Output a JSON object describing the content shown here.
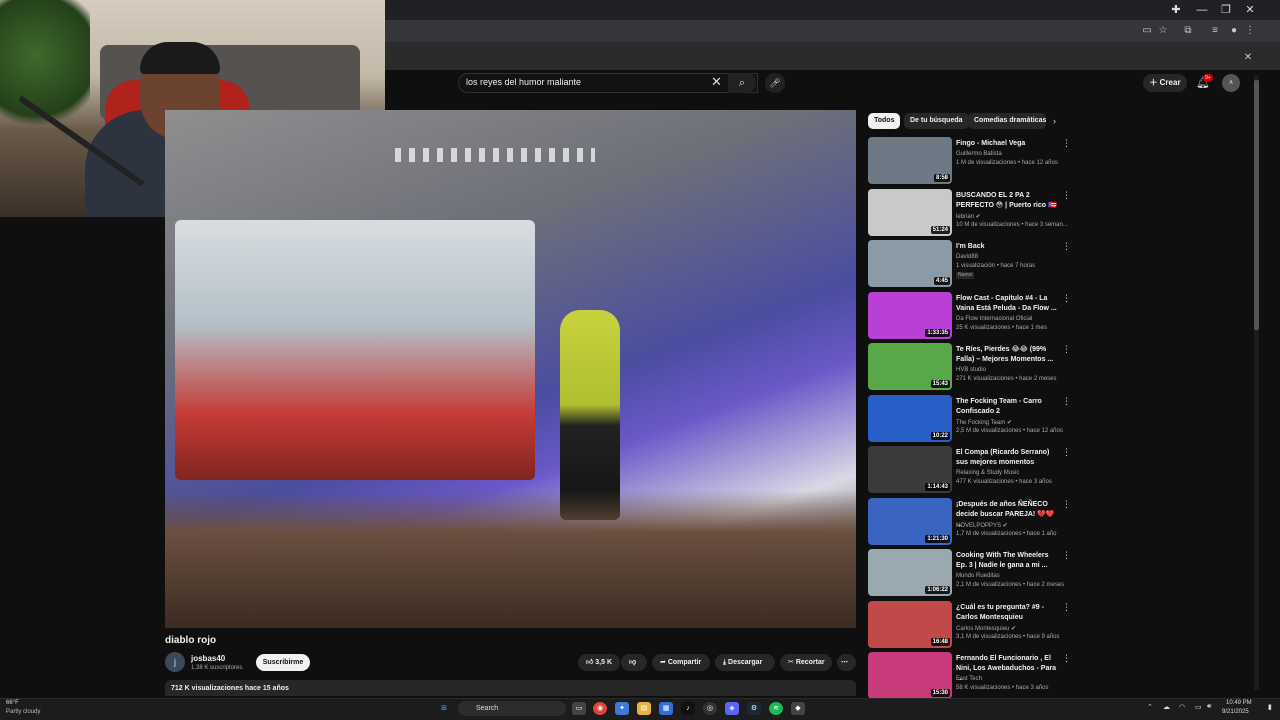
{
  "search": {
    "query": "los reyes del humor maliante"
  },
  "header": {
    "create_label": "Crear",
    "notif_count": "9+",
    "avatar_label": "A"
  },
  "video": {
    "title": "diablo rojo",
    "channel_initial": "j",
    "channel_name": "josbas40",
    "subscribers": "1,38 K suscriptores",
    "subscribe_label": "Suscribirme",
    "likes": "3,5 K",
    "share_label": "Compartir",
    "download_label": "Descargar",
    "clip_label": "Recortar",
    "description_meta": "712 K visualizaciones  hace 15 años"
  },
  "chips": [
    "Todos",
    "De tu búsqueda",
    "Comedias dramáticas"
  ],
  "recommendations": [
    {
      "title": "Fingo - Michael Vega",
      "channel": "Guillermo Batista",
      "meta": "1 M de visualizaciones • hace 12 años",
      "duration": "8:58",
      "thumb_color": "#6d7a86"
    },
    {
      "title": "BUSCANDO EL 2 PA 2 PERFECTO 😳 | Puerto rico 🇵🇷",
      "channel": "lebrian ✔",
      "meta": "10 M de visualizaciones • hace 3 seman...",
      "duration": "51:24",
      "thumb_color": "#c9c9c9"
    },
    {
      "title": "I'm Back",
      "channel": "David88",
      "meta": "1 visualización • hace 7 horas",
      "duration": "4:45",
      "badge": "Nuevo",
      "thumb_color": "#8a9aa6"
    },
    {
      "title": "Flow Cast - Capítulo #4 - La Vaina Está Peluda - Da Flow ...",
      "channel": "Da Flow Internacional Oficial",
      "meta": "25 K visualizaciones • hace 1 mes",
      "duration": "1:33:35",
      "thumb_color": "#b93fd6"
    },
    {
      "title": "Te Ríes, Pierdes 😂😂 (99% Falla) – Mejores Momentos ...",
      "channel": "HVB studio",
      "meta": "271 K visualizaciones • hace 2 meses",
      "duration": "15:43",
      "thumb_color": "#58a84a"
    },
    {
      "title": "The Focking Team - Carro Confiscado 2",
      "channel": "The Focking Team ✔",
      "meta": "2,5 M de visualizaciones • hace 12 años",
      "duration": "10:22",
      "thumb_color": "#2860c8"
    },
    {
      "title": "El Compa (Ricardo Serrano) sus mejores momentos",
      "channel": "Relaxing & Study Music",
      "meta": "477 K visualizaciones • hace 3 años",
      "duration": "1:14:43",
      "thumb_color": "#3b3b3b"
    },
    {
      "title": "¡Después de años ÑEÑECO decide buscar PAREJA! 💔❤️ ...",
      "channel": "NOVELPOPPYS ✔",
      "meta": "1,7 M de visualizaciones • hace 1 año",
      "duration": "1:21:30",
      "thumb_color": "#3a64c0"
    },
    {
      "title": "Cooking With The Wheelers Ep. 3 | Nadie le gana a mi ...",
      "channel": "Mundo Rueditas",
      "meta": "2,1 M de visualizaciones • hace 2 meses",
      "duration": "1:06:22",
      "thumb_color": "#9aa8b0"
    },
    {
      "title": "¿Cuál es tu pregunta? #9 - Carlos Montesquieu",
      "channel": "Carlos Montesquieu ✔",
      "meta": "3,1 M de visualizaciones • hace 9 años",
      "duration": "16:48",
      "thumb_color": "#c04a4a"
    },
    {
      "title": "Fernando El Funcionario , El Nini, Los Awebaduchos - Para ...",
      "channel": "Fast Tech",
      "meta": "58 K visualizaciones • hace 3 años",
      "duration": "15:30",
      "thumb_color": "#c83a7a"
    }
  ],
  "taskbar": {
    "temp": "66°F",
    "weather": "Partly cloudy",
    "search_label": "Search",
    "time": "10:49 PM",
    "date": "9/21/2025"
  },
  "colors": {
    "background": "#0f0f0f",
    "accent": "#cc0000",
    "chip_active": "#f1f1f1"
  }
}
